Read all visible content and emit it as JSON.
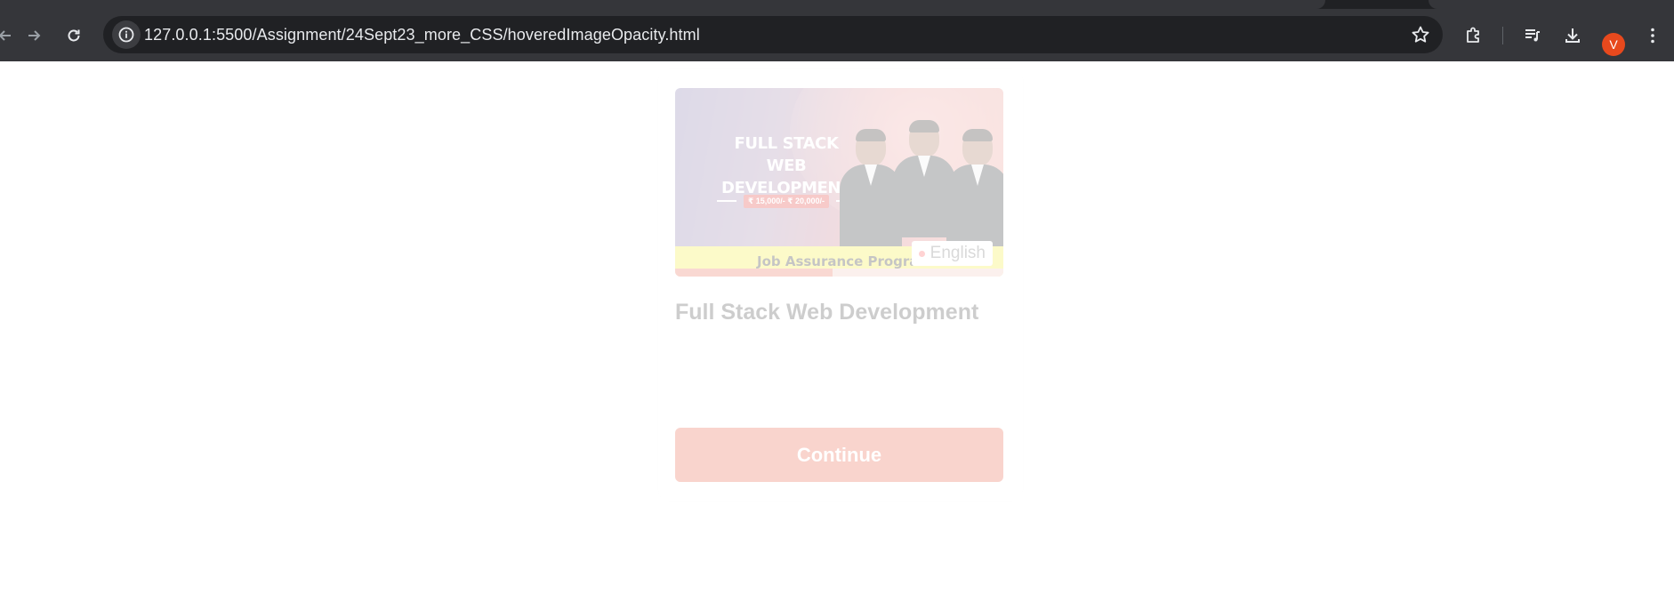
{
  "browser": {
    "url": "127.0.0.1:5500/Assignment/24Sept23_more_CSS/hoveredImageOpacity.html",
    "profile_initial": "V",
    "profile_color": "#e8491d",
    "icons": {
      "back": "back-arrow-icon",
      "forward": "forward-arrow-icon",
      "reload": "reload-icon",
      "site_info": "info-icon",
      "bookmark": "star-icon",
      "extensions": "puzzle-icon",
      "media": "playlist-icon",
      "downloads": "download-icon",
      "menu": "kebab-menu-icon"
    }
  },
  "card": {
    "banner": {
      "headline_line1": "FULL STACK",
      "headline_line2": "WEB DEVELOPMENT",
      "price_tag": "₹ 15,000/- ₹ 20,000/-",
      "strip_text": "Job Assurance Program",
      "language": "English",
      "progress_percent": 48
    },
    "title": "Full Stack Web Development",
    "button_label": "Continue",
    "accent_color": "#e8583e"
  }
}
